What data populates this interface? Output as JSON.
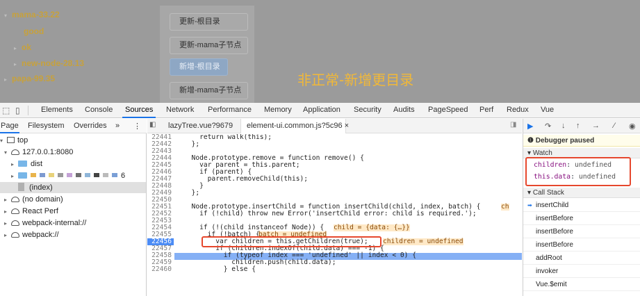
{
  "app": {
    "tree": [
      {
        "label": "mama-33.22",
        "caret": "▾"
      },
      {
        "label": "good",
        "caret": ""
      },
      {
        "label": "ok",
        "caret": "▸"
      },
      {
        "label": "new-node-28.13",
        "caret": "▸"
      },
      {
        "label": "papa-99.35",
        "caret": "▸"
      }
    ],
    "buttons": [
      "更新-根目录",
      "更新-mama子节点",
      "新增-根目录",
      "新增-mama子节点"
    ],
    "overlay_text": "非正常-新增更目录"
  },
  "devtools": {
    "panels": [
      "Elements",
      "Console",
      "Sources",
      "Network",
      "Performance",
      "Memory",
      "Application",
      "Security",
      "Audits",
      "PageSpeed",
      "Perf",
      "Redux",
      "Vue"
    ],
    "active_panel": "Sources",
    "navigator_tabs": [
      "Page",
      "Filesystem",
      "Overrides",
      "»"
    ],
    "navigator": {
      "top": "top",
      "host": "127.0.0.1:8080",
      "dist": "dist",
      "blurred_num": "6",
      "index": "(index)",
      "no_domain": "(no domain)",
      "react_perf": "React Perf",
      "webpack_internal": "webpack-internal://",
      "webpack": "webpack://"
    },
    "editor_tabs": [
      "lazyTree.vue?9679",
      "element-ui.common.js?5c96 ×"
    ],
    "code_lines": [
      {
        "n": "22441",
        "t": "    return walk(this);"
      },
      {
        "n": "22442",
        "t": "  };"
      },
      {
        "n": "22443",
        "t": ""
      },
      {
        "n": "22444",
        "t": "  Node.prototype.remove = function remove() {"
      },
      {
        "n": "22445",
        "t": "    var parent = this.parent;"
      },
      {
        "n": "22446",
        "t": "    if (parent) {"
      },
      {
        "n": "22447",
        "t": "      parent.removeChild(this);"
      },
      {
        "n": "22448",
        "t": "    }"
      },
      {
        "n": "22449",
        "t": "  };"
      },
      {
        "n": "22450",
        "t": ""
      },
      {
        "n": "22451",
        "t": "  Node.prototype.insertChild = function insertChild(child, index, batch) {"
      },
      {
        "n": "22452",
        "t": "    if (!child) throw new Error('insertChild error: child is required.');"
      },
      {
        "n": "22453",
        "t": ""
      },
      {
        "n": "22454",
        "t": "    if (!(child instanceof Node)) {"
      },
      {
        "n": "22455",
        "t": "      if (!batch) {"
      },
      {
        "n": "22456",
        "t": "        var children = this.getChildren(true);"
      },
      {
        "n": "22457",
        "t": "        if (children.indexOf(child.data) === -1) {"
      },
      {
        "n": "22458",
        "t": "          if (typeof index === 'undefined' || index < 0) {"
      },
      {
        "n": "22459",
        "t": "            children.push(child.data);"
      },
      {
        "n": "22460",
        "t": "          } else {"
      }
    ],
    "inline_values": {
      "l22451": "ch",
      "l22454": "child = {data: {…}}",
      "l22455": "batch = undefined",
      "l22456": "children = undefined"
    },
    "breakpoint_line": "22456",
    "paused_label": "Debugger paused",
    "watch_header": "Watch",
    "watch": [
      {
        "name": "children",
        "value": "undefined"
      },
      {
        "name": "this.data",
        "value": "undefined"
      }
    ],
    "callstack_header": "Call Stack",
    "callstack": [
      "insertChild",
      "insertBefore",
      "insertBefore",
      "insertBefore",
      "addRoot",
      "invoker",
      "Vue.$emit"
    ]
  },
  "colors": {
    "accent": "#1a73e8",
    "highlight": "#e6472d",
    "overlay": "#f1b838"
  }
}
